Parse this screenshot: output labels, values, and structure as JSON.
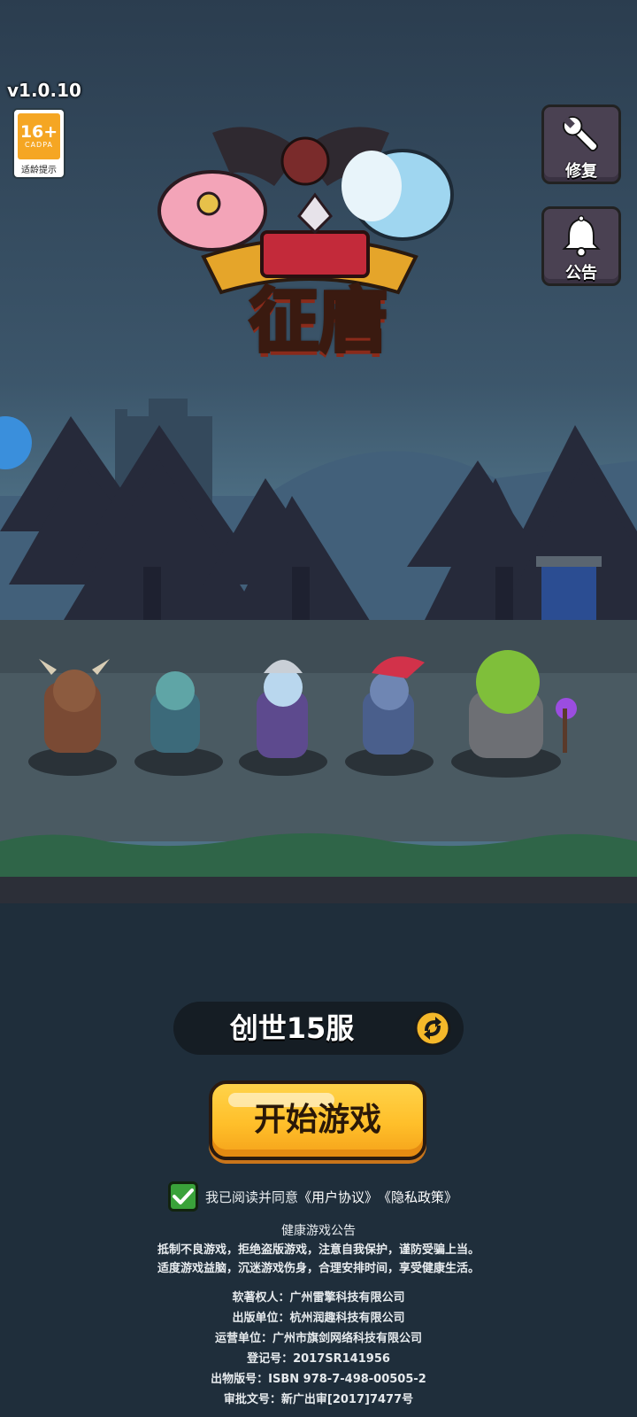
{
  "version": "v1.0.10",
  "age_rating": {
    "number": "16+",
    "org": "CADPA",
    "tip": "适龄提示"
  },
  "logo": {
    "title": "征唐"
  },
  "side_buttons": {
    "repair": {
      "label": "修复",
      "icon": "wrench-icon"
    },
    "notice": {
      "label": "公告",
      "icon": "bell-icon"
    }
  },
  "server": {
    "name": "创世15服",
    "switch_icon": "switch-server-icon"
  },
  "start_button": {
    "label": "开始游戏"
  },
  "agreement": {
    "checked": true,
    "text": "我已阅读并同意",
    "user_agreement": "《用户协议》",
    "privacy_policy": "《隐私政策》"
  },
  "health_notice": {
    "title": "健康游戏公告",
    "line1": "抵制不良游戏，拒绝盗版游戏，注意自我保护，谨防受骗上当。",
    "line2": "适度游戏益脑，沉迷游戏伤身，合理安排时间，享受健康生活。"
  },
  "publisher_info": {
    "copyright_owner": "软著权人：广州雷擎科技有限公司",
    "publisher": "出版单位：杭州润趣科技有限公司",
    "operator": "运营单位：广州市旗剑网络科技有限公司",
    "registration": "登记号：2017SR141956",
    "isbn": "出物版号：ISBN 978-7-498-00505-2",
    "approval": "审批文号：新广出审[2017]7477号"
  },
  "colors": {
    "start_button": "#ffbf2a",
    "checkbox": "#3aa23a",
    "side_button": "#4a4152",
    "background_bottom": "#1f2e3b"
  }
}
